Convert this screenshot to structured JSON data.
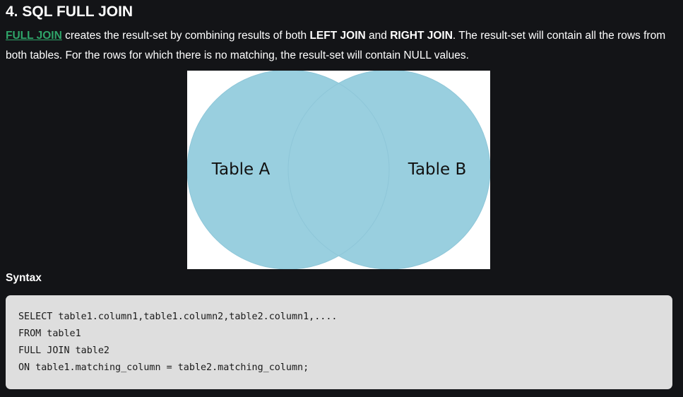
{
  "heading": "4. SQL FULL JOIN",
  "intro": {
    "link_text": "FULL JOIN",
    "text_1": " creates the result-set by combining results of both ",
    "bold_1": "LEFT JOIN",
    "text_2": " and ",
    "bold_2": "RIGHT JOIN",
    "text_3": ". The result-set will contain all the rows from both tables. For the rows for which there is no matching, the result-set will contain NULL values."
  },
  "venn": {
    "label_a": "Table A",
    "label_b": "Table B",
    "fill_color": "#99cfdf",
    "background_color": "#ffffff"
  },
  "syntax_label": "Syntax",
  "code_lines": [
    "SELECT table1.column1,table1.column2,table2.column1,....",
    "FROM table1",
    "FULL JOIN table2",
    "ON table1.matching_column = table2.matching_column;"
  ],
  "colors": {
    "page_background": "#131417",
    "link": "#2fa66a",
    "code_background": "#dedede"
  }
}
